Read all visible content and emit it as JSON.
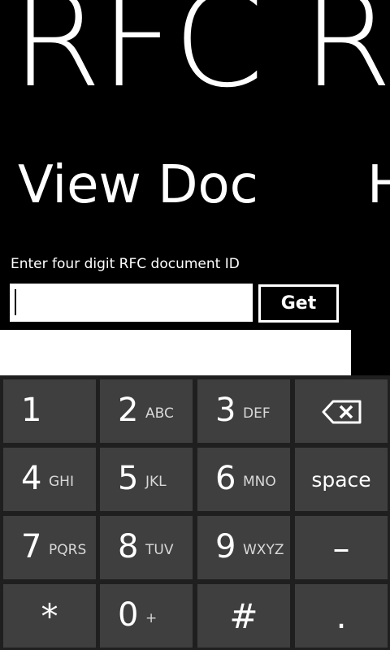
{
  "app": {
    "title": "RFC R",
    "pivot_current": "View Doc",
    "pivot_next": "H"
  },
  "form": {
    "prompt": "Enter four digit RFC document ID",
    "input_value": "",
    "get_label": "Get"
  },
  "keypad": {
    "rows": [
      [
        {
          "digit": "1",
          "letters": ""
        },
        {
          "digit": "2",
          "letters": "ABC"
        },
        {
          "digit": "3",
          "letters": "DEF"
        },
        {
          "icon": "backspace-icon"
        }
      ],
      [
        {
          "digit": "4",
          "letters": "GHI"
        },
        {
          "digit": "5",
          "letters": "JKL"
        },
        {
          "digit": "6",
          "letters": "MNO"
        },
        {
          "label": "space"
        }
      ],
      [
        {
          "digit": "7",
          "letters": "PQRS"
        },
        {
          "digit": "8",
          "letters": "TUV"
        },
        {
          "digit": "9",
          "letters": "WXYZ"
        },
        {
          "symbol": "–"
        }
      ],
      [
        {
          "symbol": "*"
        },
        {
          "digit": "0",
          "letters": "+"
        },
        {
          "symbol": "#"
        },
        {
          "symbol": "."
        }
      ]
    ]
  },
  "colors": {
    "background": "#000000",
    "key": "#3f3f3f",
    "keypad_bg": "#1f1f1f",
    "text": "#ffffff"
  }
}
